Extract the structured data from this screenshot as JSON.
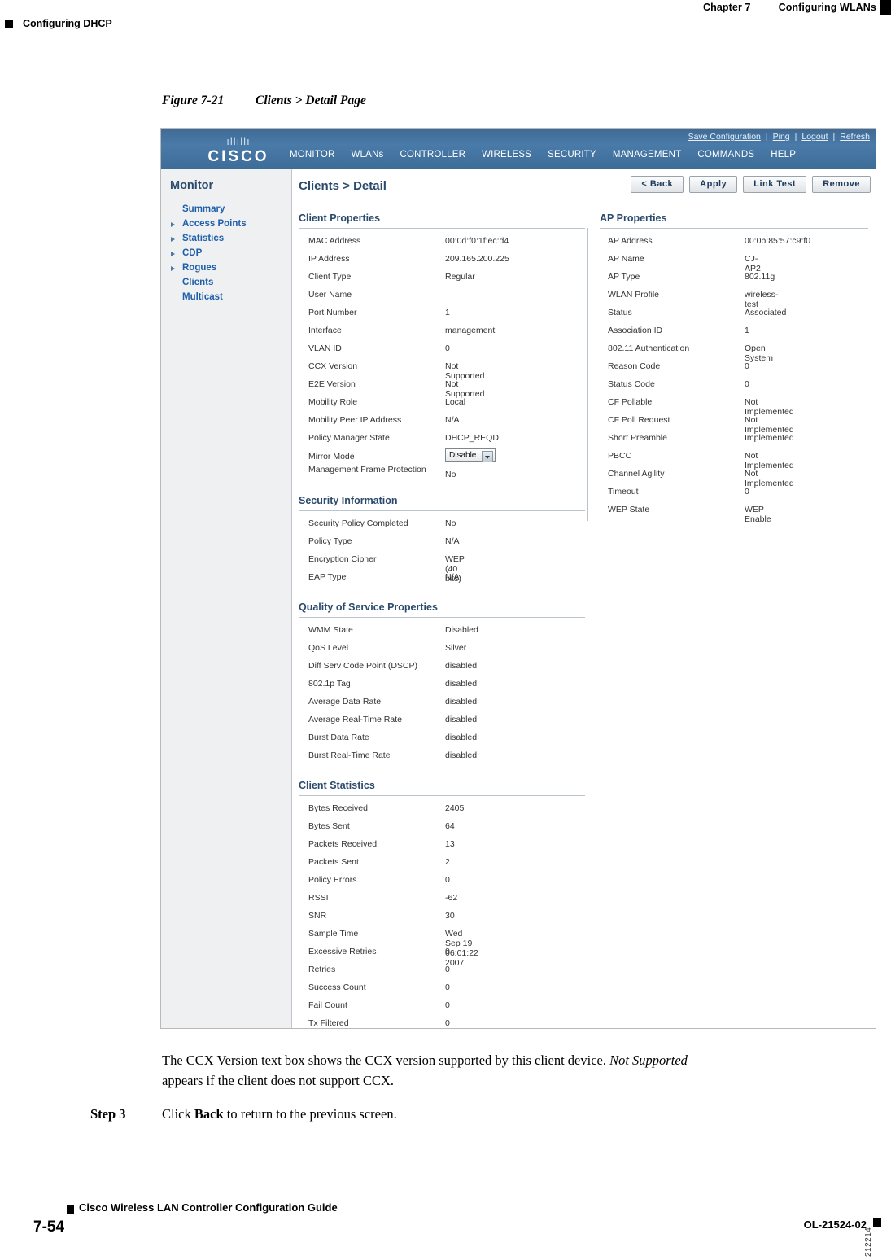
{
  "header": {
    "chapter": "Chapter 7",
    "chapter_title": "Configuring WLANs",
    "section": "Configuring DHCP"
  },
  "figure": {
    "number": "Figure 7-21",
    "title": "Clients > Detail Page",
    "image_id": "212214"
  },
  "screenshot": {
    "brand": "CISCO",
    "logo_bars": "ıllıllı",
    "top_links": [
      "Save Configuration",
      "Ping",
      "Logout",
      "Refresh"
    ],
    "nav": [
      "MONITOR",
      "WLANs",
      "CONTROLLER",
      "WIRELESS",
      "SECURITY",
      "MANAGEMENT",
      "COMMANDS",
      "HELP"
    ],
    "sidebar": {
      "title": "Monitor",
      "items": [
        {
          "label": "Summary",
          "arrow": false
        },
        {
          "label": "Access Points",
          "arrow": true
        },
        {
          "label": "Statistics",
          "arrow": true
        },
        {
          "label": "CDP",
          "arrow": true
        },
        {
          "label": "Rogues",
          "arrow": true
        },
        {
          "label": "Clients",
          "arrow": false
        },
        {
          "label": "Multicast",
          "arrow": false
        }
      ]
    },
    "page_title": "Clients > Detail",
    "buttons": [
      "< Back",
      "Apply",
      "Link Test",
      "Remove"
    ],
    "sections": {
      "client_properties": {
        "title": "Client Properties",
        "rows": [
          {
            "k": "MAC Address",
            "v": "00:0d:f0:1f:ec:d4"
          },
          {
            "k": "IP Address",
            "v": "209.165.200.225"
          },
          {
            "k": "Client Type",
            "v": "Regular"
          },
          {
            "k": "User Name",
            "v": ""
          },
          {
            "k": "Port Number",
            "v": "1"
          },
          {
            "k": "Interface",
            "v": "management"
          },
          {
            "k": "VLAN ID",
            "v": "0"
          },
          {
            "k": "CCX Version",
            "v": "Not Supported"
          },
          {
            "k": "E2E Version",
            "v": "Not Supported"
          },
          {
            "k": "Mobility Role",
            "v": "Local"
          },
          {
            "k": "Mobility Peer IP Address",
            "v": "N/A"
          },
          {
            "k": "Policy Manager State",
            "v": "DHCP_REQD"
          },
          {
            "k": "Mirror Mode",
            "v": "__SELECT__"
          },
          {
            "k": "Management Frame Protection",
            "v": "No"
          }
        ],
        "mirror_mode_value": "Disable"
      },
      "ap_properties": {
        "title": "AP Properties",
        "rows": [
          {
            "k": "AP Address",
            "v": "00:0b:85:57:c9:f0"
          },
          {
            "k": "AP Name",
            "v": "CJ-AP2"
          },
          {
            "k": "AP Type",
            "v": "802.11g"
          },
          {
            "k": "WLAN Profile",
            "v": "wireless-test"
          },
          {
            "k": "Status",
            "v": "Associated"
          },
          {
            "k": "Association ID",
            "v": "1"
          },
          {
            "k": "802.11 Authentication",
            "v": "Open System"
          },
          {
            "k": "Reason Code",
            "v": "0"
          },
          {
            "k": "Status Code",
            "v": "0"
          },
          {
            "k": "CF Pollable",
            "v": "Not Implemented"
          },
          {
            "k": "CF Poll Request",
            "v": "Not Implemented"
          },
          {
            "k": "Short Preamble",
            "v": "Implemented"
          },
          {
            "k": "PBCC",
            "v": "Not Implemented"
          },
          {
            "k": "Channel Agility",
            "v": "Not Implemented"
          },
          {
            "k": "Timeout",
            "v": "0"
          },
          {
            "k": "WEP State",
            "v": "WEP Enable"
          }
        ]
      },
      "security_information": {
        "title": "Security Information",
        "rows": [
          {
            "k": "Security Policy Completed",
            "v": "No"
          },
          {
            "k": "Policy Type",
            "v": "N/A"
          },
          {
            "k": "Encryption Cipher",
            "v": "WEP (40 bits)"
          },
          {
            "k": "EAP Type",
            "v": "N/A"
          }
        ]
      },
      "qos_properties": {
        "title": "Quality of Service Properties",
        "rows": [
          {
            "k": "WMM State",
            "v": "Disabled"
          },
          {
            "k": "QoS Level",
            "v": "Silver"
          },
          {
            "k": "Diff Serv Code Point (DSCP)",
            "v": "disabled"
          },
          {
            "k": "802.1p Tag",
            "v": "disabled"
          },
          {
            "k": "Average Data Rate",
            "v": "disabled"
          },
          {
            "k": "Average Real-Time Rate",
            "v": "disabled"
          },
          {
            "k": "Burst Data Rate",
            "v": "disabled"
          },
          {
            "k": "Burst Real-Time Rate",
            "v": "disabled"
          }
        ]
      },
      "client_statistics": {
        "title": "Client Statistics",
        "rows": [
          {
            "k": "Bytes Received",
            "v": "2405"
          },
          {
            "k": "Bytes Sent",
            "v": "64"
          },
          {
            "k": "Packets Received",
            "v": "13"
          },
          {
            "k": "Packets Sent",
            "v": "2"
          },
          {
            "k": "Policy Errors",
            "v": "0"
          },
          {
            "k": "RSSI",
            "v": "-62"
          },
          {
            "k": "SNR",
            "v": "30"
          },
          {
            "k": "Sample Time",
            "v": "Wed Sep 19 06:01:22 2007"
          },
          {
            "k": "Excessive Retries",
            "v": "0"
          },
          {
            "k": "Retries",
            "v": "0"
          },
          {
            "k": "Success Count",
            "v": "0"
          },
          {
            "k": "Fail Count",
            "v": "0"
          },
          {
            "k": "Tx Filtered",
            "v": "0"
          }
        ]
      }
    }
  },
  "body": {
    "paragraph_line1_a": "The CCX Version text box shows the CCX version supported by this client device. ",
    "paragraph_line1_b": "Not Supported",
    "paragraph_line2": "appears if the client does not support CCX.",
    "step_label": "Step 3",
    "step_text_a": "Click ",
    "step_text_b": "Back",
    "step_text_c": " to return to the previous screen."
  },
  "footer": {
    "guide_title": "Cisco Wireless LAN Controller Configuration Guide",
    "page_number": "7-54",
    "doc_number": "OL-21524-02"
  }
}
